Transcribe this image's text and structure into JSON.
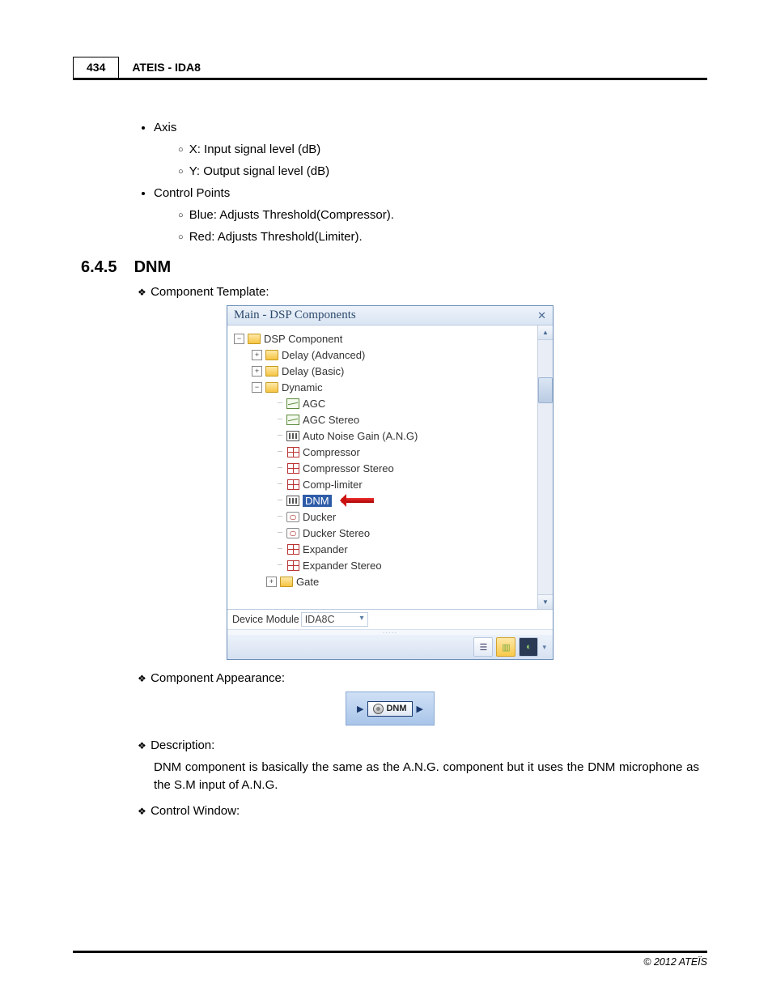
{
  "header": {
    "page_number": "434",
    "title": "ATEIS - IDA8"
  },
  "bullets": {
    "axis": {
      "label": "Axis",
      "x": "X: Input signal level (dB)",
      "y": "Y: Output signal level (dB)"
    },
    "control_points": {
      "label": "Control Points",
      "blue": "Blue: Adjusts Threshold(Compressor).",
      "red": "Red: Adjusts Threshold(Limiter)."
    }
  },
  "section": {
    "number": "6.4.5",
    "title": "DNM"
  },
  "labels": {
    "component_template": "Component Template:",
    "component_appearance": "Component Appearance:",
    "description": "Description:",
    "control_window": "Control Window:"
  },
  "panel": {
    "title": "Main - DSP Components",
    "device_label": "Device Module",
    "device_value": "IDA8C",
    "tree": {
      "root": "DSP Component",
      "delay_adv": "Delay (Advanced)",
      "delay_basic": "Delay (Basic)",
      "dynamic": "Dynamic",
      "agc": "AGC",
      "agc_stereo": "AGC Stereo",
      "ang": "Auto Noise Gain (A.N.G)",
      "compressor": "Compressor",
      "compressor_stereo": "Compressor Stereo",
      "comp_limiter": "Comp-limiter",
      "dnm": "DNM",
      "ducker": "Ducker",
      "ducker_stereo": "Ducker Stereo",
      "expander": "Expander",
      "expander_stereo": "Expander Stereo",
      "gate": "Gate"
    }
  },
  "appearance_badge": "DNM",
  "description_body": "DNM component is basically the same as the A.N.G. component but it uses the DNM microphone as the S.M input of A.N.G.",
  "footer": "© 2012 ATEÏS"
}
